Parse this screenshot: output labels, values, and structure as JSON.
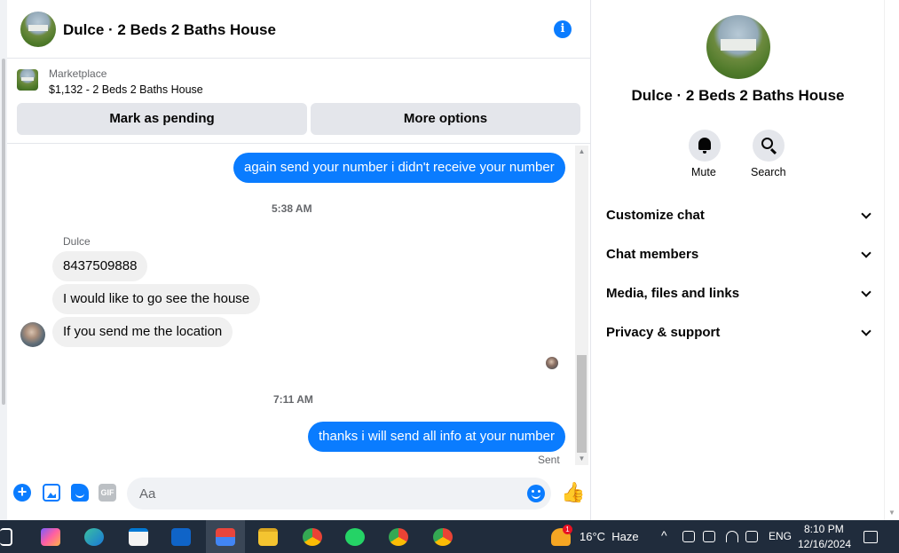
{
  "header": {
    "title": "Dulce · 2 Beds 2 Baths House",
    "info_icon": "info-icon"
  },
  "marketplace": {
    "label": "Marketplace",
    "item": "$1,132 - 2 Beds 2 Baths House",
    "pending_button": "Mark as pending",
    "more_button": "More options"
  },
  "messages": {
    "out1": "again send your number i didn't receive your number",
    "time1": "5:38 AM",
    "sender": "Dulce",
    "in1": "8437509888",
    "in2": "I would like to go see the house",
    "in3": "If you send me the location",
    "time2": "7:11 AM",
    "out2": "thanks i will send all info at your number",
    "status": "Sent"
  },
  "composer": {
    "placeholder": "Aa",
    "gif_label": "GIF",
    "icons": [
      "plus-icon",
      "image-icon",
      "sticker-icon",
      "gif-icon",
      "emoji-icon",
      "like-icon"
    ]
  },
  "sidebar": {
    "title": "Dulce · 2 Beds 2 Baths House",
    "mute_label": "Mute",
    "search_label": "Search",
    "items": [
      {
        "label": "Customize chat"
      },
      {
        "label": "Chat members"
      },
      {
        "label": "Media, files and links"
      },
      {
        "label": "Privacy & support"
      }
    ]
  },
  "taskbar": {
    "weather": "16°C  Haze",
    "weather_badge": "1",
    "language": "ENG",
    "time": "8:10 PM",
    "date": "12/16/2024"
  },
  "colors": {
    "accent": "#0a7cff",
    "bubble_in": "#f0f0f0",
    "taskbar": "#202c3c"
  }
}
